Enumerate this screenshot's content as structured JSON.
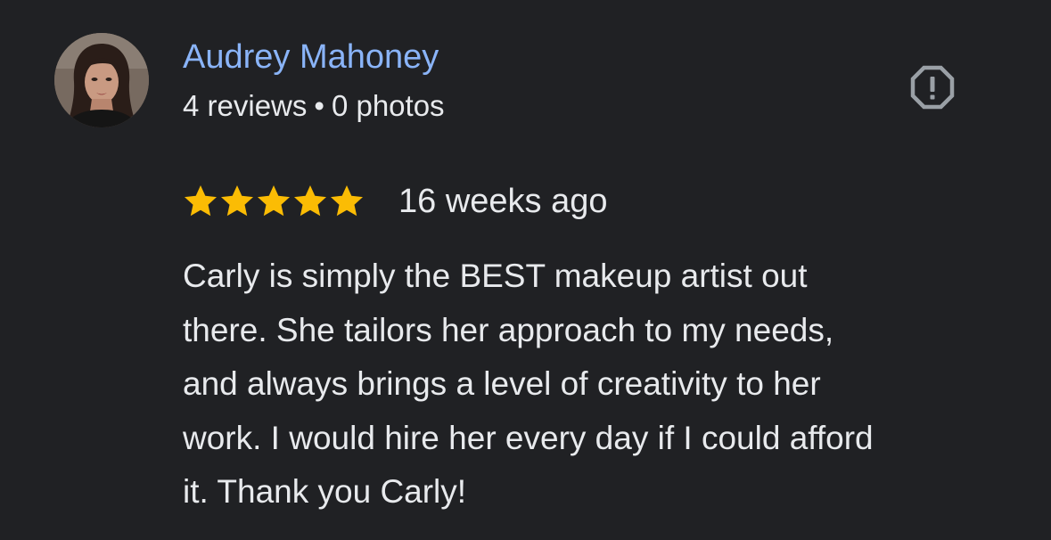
{
  "reviewer": {
    "name": "Audrey Mahoney",
    "reviews_count": "4 reviews",
    "separator": "•",
    "photos_count": "0 photos",
    "avatar_icon": "profile-photo"
  },
  "report_icon": "report-flag-icon",
  "review": {
    "rating": 5,
    "max_rating": 5,
    "star_color": "#fbbc04",
    "date": "16 weeks ago",
    "text_lines": [
      "Carly is simply the BEST makeup artist out",
      "there. She tailors her approach to my needs,",
      "and always brings a level of creativity to her",
      "work. I would hire her every day if I could afford",
      "it. Thank you Carly!"
    ]
  },
  "colors": {
    "background": "#202124",
    "name_link": "#8ab4f8",
    "text": "#e8eaed",
    "icon": "#9aa0a6"
  }
}
